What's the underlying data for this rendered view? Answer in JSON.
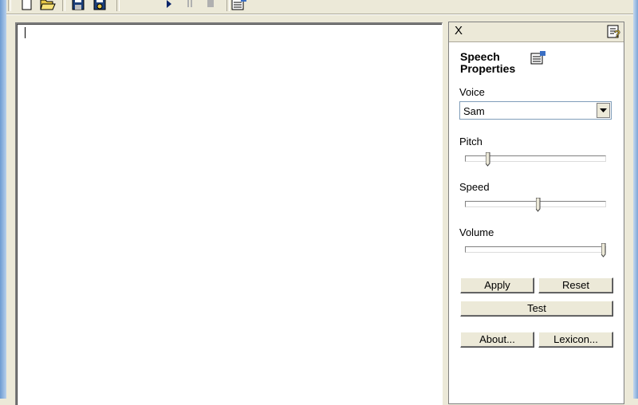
{
  "toolbar": {
    "buttons": [
      {
        "name": "new-document-icon"
      },
      {
        "name": "open-folder-icon"
      },
      {
        "name": "save-icon"
      },
      {
        "name": "save-as-audio-icon"
      },
      {
        "name": "play-icon"
      },
      {
        "name": "pause-icon"
      },
      {
        "name": "stop-icon"
      },
      {
        "name": "properties-icon"
      }
    ]
  },
  "editor": {
    "text": ""
  },
  "panel": {
    "close_label": "X",
    "title": "Speech Properties",
    "voice": {
      "label": "Voice",
      "selected": "Sam"
    },
    "pitch": {
      "label": "Pitch",
      "value": 0.15
    },
    "speed": {
      "label": "Speed",
      "value": 0.52
    },
    "volume": {
      "label": "Volume",
      "value": 1.0
    },
    "buttons": {
      "apply": "Apply",
      "reset": "Reset",
      "test": "Test",
      "about": "About...",
      "lexicon": "Lexicon..."
    }
  },
  "colors": {
    "chrome": "#ece9d8",
    "play_blue": "#0a246a"
  }
}
